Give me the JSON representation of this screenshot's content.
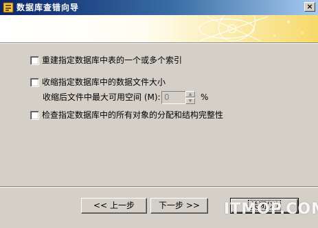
{
  "window": {
    "title": "数据库查错向导",
    "close_glyph": "×"
  },
  "options": [
    {
      "label": "重建指定数据库中表的一个或多个索引",
      "checked": false
    },
    {
      "label": "收缩指定数据库中的数据文件大小",
      "checked": false
    },
    {
      "label": "检查指定数据库中的所有对象的分配和结构完整性",
      "checked": false
    }
  ],
  "shrink": {
    "label": "收缩后文件中最大可用空间 (M):",
    "value": "0",
    "unit": "%"
  },
  "buttons": {
    "prev": "<< 上一步",
    "next": "下一步 >>",
    "close": "关闭(X)"
  },
  "watermark": "ITMOP.COM",
  "colors": {
    "titlebar_start": "#0a246a",
    "banner_accent": "#f7d96a",
    "window_bg": "#d4d0c8"
  }
}
